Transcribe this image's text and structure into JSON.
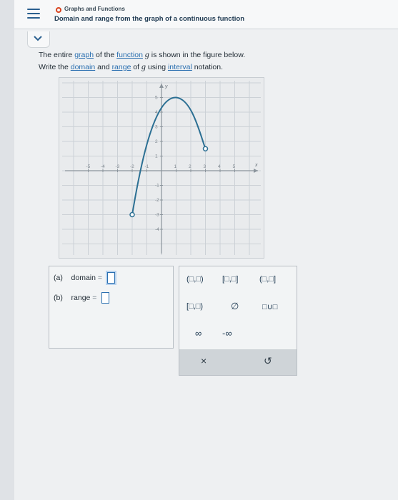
{
  "header": {
    "topic": "Graphs and Functions",
    "title": "Domain and range from the graph of a continuous function"
  },
  "prompt": {
    "line1_pre": "The entire ",
    "link_graph": "graph",
    "line1_mid": " of the ",
    "link_function": "function",
    "var_g": "g",
    "line1_post": " is shown in the figure below.",
    "line2_pre": "Write the ",
    "link_domain": "domain",
    "line2_and": " and ",
    "link_range": "range",
    "line2_of": " of ",
    "line2_using": " using ",
    "link_interval": "interval",
    "line2_post": " notation."
  },
  "graph": {
    "x_ticks": [
      "-5",
      "-4",
      "-3",
      "-2",
      "-1",
      "1",
      "2",
      "3",
      "4",
      "5"
    ],
    "y_ticks": [
      "5",
      "4",
      "3",
      "2",
      "1",
      "-1",
      "-2",
      "-3",
      "-4"
    ],
    "x_axis_label": "x",
    "y_axis_label": "y",
    "curve_color": "#2b6f93",
    "endpoints": [
      {
        "x": -2,
        "y": -3,
        "filled": false
      },
      {
        "x": 3,
        "y": 1.5,
        "filled": false
      }
    ],
    "max_point": {
      "x": 1,
      "y": 5
    }
  },
  "answers": {
    "a_label": "(a)",
    "a_field": "domain",
    "b_label": "(b)",
    "b_field": "range",
    "equals": "="
  },
  "keypad": {
    "open_open": "(□,□)",
    "closed_closed": "[□,□]",
    "open_closed": "(□,□]",
    "closed_open": "[□,□)",
    "empty_set": "∅",
    "union": "□∪□",
    "infinity": "∞",
    "neg_infinity": "-∞",
    "clear": "×",
    "undo": "↺"
  },
  "colors": {
    "accent": "#2a6fb0",
    "topic_dot": "#d8431f"
  }
}
